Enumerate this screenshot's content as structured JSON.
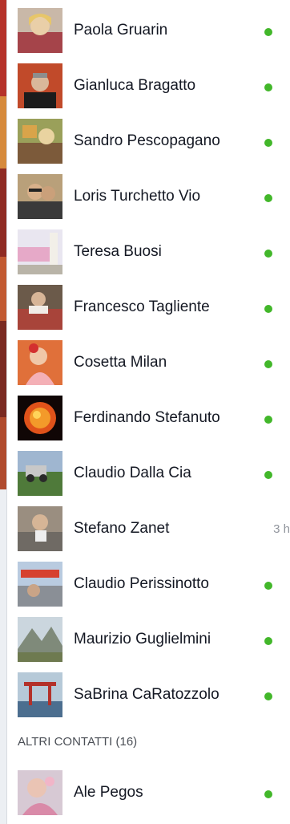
{
  "contacts": [
    {
      "name": "Paola Gruarin",
      "status": "online",
      "avatar_icon": "user-photo-avatar"
    },
    {
      "name": "Gianluca Bragatto",
      "status": "online",
      "avatar_icon": "user-photo-avatar"
    },
    {
      "name": "Sandro Pescopagano",
      "status": "online",
      "avatar_icon": "user-photo-avatar"
    },
    {
      "name": "Loris Turchetto Vio",
      "status": "online",
      "avatar_icon": "user-photo-avatar"
    },
    {
      "name": "Teresa Buosi",
      "status": "online",
      "avatar_icon": "user-photo-avatar"
    },
    {
      "name": "Francesco Tagliente",
      "status": "online",
      "avatar_icon": "user-photo-avatar"
    },
    {
      "name": "Cosetta Milan",
      "status": "online",
      "avatar_icon": "user-photo-avatar"
    },
    {
      "name": "Ferdinando Stefanuto",
      "status": "online",
      "avatar_icon": "user-photo-avatar"
    },
    {
      "name": "Claudio Dalla Cia",
      "status": "online",
      "avatar_icon": "user-photo-avatar"
    },
    {
      "name": "Stefano Zanet",
      "status": "idle",
      "last_seen": "3 h",
      "avatar_icon": "user-photo-avatar"
    },
    {
      "name": "Claudio Perissinotto",
      "status": "online",
      "avatar_icon": "user-photo-avatar"
    },
    {
      "name": "Maurizio Guglielmini",
      "status": "online",
      "avatar_icon": "user-photo-avatar"
    },
    {
      "name": "SaBrina CaRatozzolo",
      "status": "online",
      "avatar_icon": "user-photo-avatar"
    }
  ],
  "other_contacts": {
    "header": "ALTRI CONTATTI (16)",
    "items": [
      {
        "name": "Ale Pegos",
        "status": "online",
        "avatar_icon": "user-photo-avatar"
      }
    ]
  },
  "colors": {
    "online_dot": "#42b72a",
    "name_text": "#141823",
    "muted_text": "#90949c"
  }
}
